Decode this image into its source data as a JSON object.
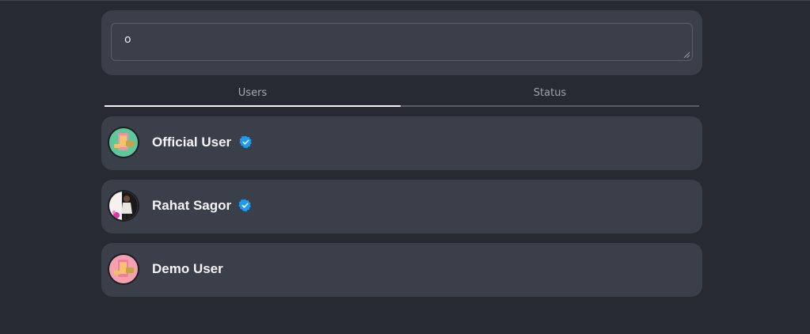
{
  "search": {
    "value": "o"
  },
  "tabs": [
    {
      "label": "Users",
      "active": true
    },
    {
      "label": "Status",
      "active": false
    }
  ],
  "users": [
    {
      "name": "Official User",
      "verified": true,
      "avatar": "cartoon-phone-avatar",
      "avatar_bg": "#5fc79a"
    },
    {
      "name": "Rahat Sagor",
      "verified": true,
      "avatar": "person-photo-avatar",
      "avatar_bg": "#1a1a1a"
    },
    {
      "name": "Demo User",
      "verified": false,
      "avatar": "cartoon-phone-avatar",
      "avatar_bg": "#f6a0b0"
    }
  ],
  "colors": {
    "background": "#282a33",
    "card": "#3b3f4a",
    "verified": "#1d9bf0",
    "active_tab_underline": "#f2f2f4"
  }
}
